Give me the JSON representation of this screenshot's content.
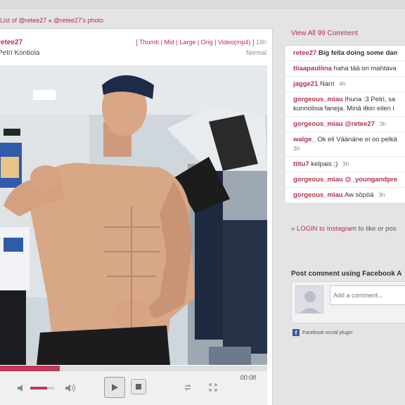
{
  "breadcrumb": {
    "list_label": "List of @retee27",
    "separator": "»",
    "photo_label": "@retee27's photo"
  },
  "post": {
    "username": "retee27",
    "full_name": "Petri Kontiola",
    "size_links": [
      "Thumb",
      "Mid",
      "Large",
      "Orig",
      "Video(mp4)"
    ],
    "time": "18h",
    "view_mode": "Normal"
  },
  "player": {
    "time": "00:08",
    "progress": 0.23,
    "volume": 0.7
  },
  "sidebar": {
    "view_all": "View All 99 Comment",
    "comments": [
      {
        "user": "retee27",
        "text": "Big fella doing some dan",
        "when": "",
        "bold_text": true
      },
      {
        "user": "tiiaapauliina",
        "text": "haha tää on mahtava",
        "when": "",
        "bold_text": false
      },
      {
        "user": "jagge21",
        "text": "Narri",
        "when": "4h",
        "bold_text": false
      },
      {
        "user": "gorgeous_miau",
        "text": "Ihuna :3 Petri, sa",
        "text2": "kunnolisia faneja. Minä itkin eilen i",
        "when": "",
        "bold_text": false
      },
      {
        "user": "gorgeous_miau",
        "text": "@retee27",
        "when": "3h",
        "bold_text": false
      },
      {
        "user": "walge_",
        "text": "Ok eli Väänäne ei oo pelkä",
        "text2": "",
        "when": "3h",
        "bold_text": false
      },
      {
        "user": "tiitu7",
        "text": "kelpais ;)",
        "when": "3h",
        "bold_text": false
      },
      {
        "user": "gorgeous_miau",
        "text": "@_youngandpre",
        "when": "",
        "bold_text": false
      },
      {
        "user": "gorgeous_miau",
        "text": "Aw söpöä",
        "when": "3h",
        "bold_text": false
      }
    ],
    "login_prefix": "»",
    "login_link": "LOGIN to Instagram",
    "login_suffix": "to like or pos",
    "fb_title": "Post comment using Facebook A",
    "fb_placeholder": "Add a comment...",
    "fb_plugin": "Facebook social plugin"
  }
}
